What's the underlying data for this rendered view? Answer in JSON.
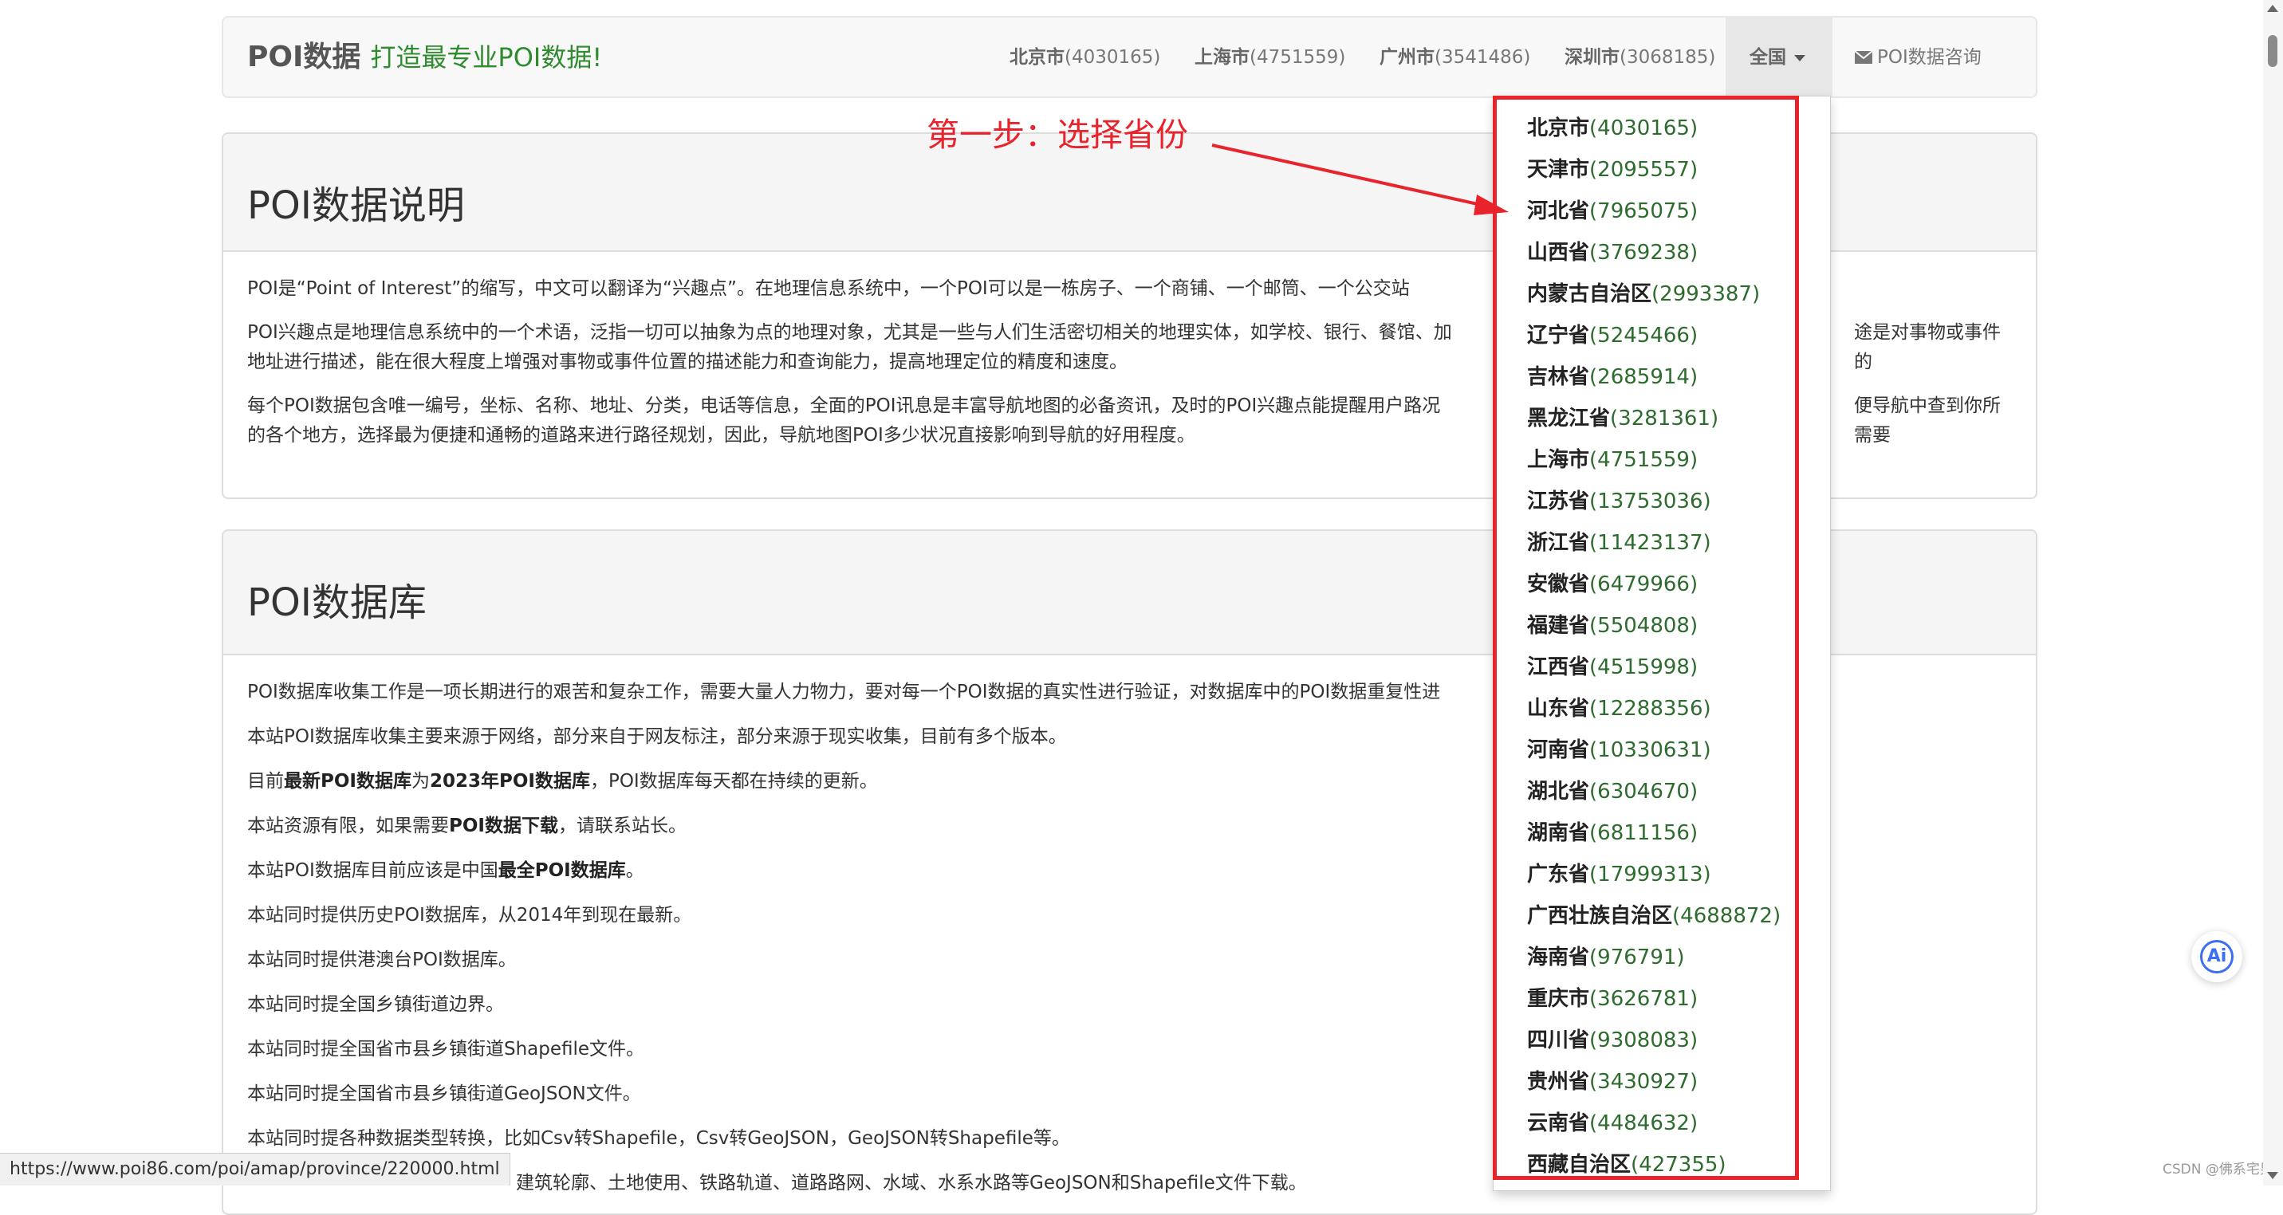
{
  "navbar": {
    "brand_name": "POI数据",
    "brand_slogan": "打造最专业POI数据!",
    "items": [
      {
        "name": "北京市",
        "count": "(4030165)"
      },
      {
        "name": "上海市",
        "count": "(4751559)"
      },
      {
        "name": "广州市",
        "count": "(3541486)"
      },
      {
        "name": "深圳市",
        "count": "(3068185)"
      }
    ],
    "dropdown_label": "全国",
    "consult_label": "POI数据咨询"
  },
  "annotation": {
    "step_label": "第一步：选择省份",
    "highlight_color": "#e8232b"
  },
  "panel1": {
    "title": "POI数据说明",
    "p1": "POI是“Point of Interest”的缩写，中文可以翻译为“兴趣点”。在地理信息系统中，一个POI可以是一栋房子、一个商铺、一个邮筒、一个公交站",
    "p2a": "POI兴趣点是地理信息系统中的一个术语，泛指一切可以抽象为点的地理对象，尤其是一些与人们生活密切相关的地理实体，如学校、银行、餐馆、加",
    "p2b": "途是对事物或事件的",
    "p2c": "地址进行描述，能在很大程度上增强对事物或事件位置的描述能力和查询能力，提高地理定位的精度和速度。",
    "p3a": "每个POI数据包含唯一编号，坐标、名称、地址、分类，电话等信息，全面的POI讯息是丰富导航地图的必备资讯，及时的POI兴趣点能提醒用户路况",
    "p3b": "便导航中查到你所需要",
    "p3c": "的各个地方，选择最为便捷和通畅的道路来进行路径规划，因此，导航地图POI多少状况直接影响到导航的好用程度。"
  },
  "panel2": {
    "title": "POI数据库",
    "l1": "POI数据库收集工作是一项长期进行的艰苦和复杂工作，需要大量人力物力，要对每一个POI数据的真实性进行验证，对数据库中的POI数据重复性进",
    "l2": "本站POI数据库收集主要来源于网络，部分来自于网友标注，部分来源于现实收集，目前有多个版本。",
    "l3_pre": "目前",
    "l3_b1": "最新POI数据库",
    "l3_mid": "为",
    "l3_b2": "2023年POI数据库",
    "l3_post": "，POI数据库每天都在持续的更新。",
    "l4_pre": "本站资源有限，如果需要",
    "l4_b": "POI数据下载",
    "l4_post": "，请联系站长。",
    "l5_pre": "本站POI数据库目前应该是中国",
    "l5_b": "最全POI数据库",
    "l5_post": "。",
    "l6": "本站同时提供历史POI数据库，从2014年到现在最新。",
    "l7": "本站同时提供港澳台POI数据库。",
    "l8": "本站同时提全国乡镇街道边界。",
    "l9": "本站同时提全国省市县乡镇街道Shapefile文件。",
    "l10": "本站同时提全国省市县乡镇街道GeoJSON文件。",
    "l11": "本站同时提各种数据类型转换，比如Csv转Shapefile，Csv转GeoJSON，GeoJSON转Shapefile等。",
    "l12": "建筑轮廓、土地使用、铁路轨道、道路路网、水域、水系水路等GeoJSON和Shapefile文件下载。"
  },
  "dropdown": {
    "items": [
      {
        "name": "北京市",
        "count": "(4030165)"
      },
      {
        "name": "天津市",
        "count": "(2095557)"
      },
      {
        "name": "河北省",
        "count": "(7965075)"
      },
      {
        "name": "山西省",
        "count": "(3769238)"
      },
      {
        "name": "内蒙古自治区",
        "count": "(2993387)"
      },
      {
        "name": "辽宁省",
        "count": "(5245466)"
      },
      {
        "name": "吉林省",
        "count": "(2685914)"
      },
      {
        "name": "黑龙江省",
        "count": "(3281361)"
      },
      {
        "name": "上海市",
        "count": "(4751559)"
      },
      {
        "name": "江苏省",
        "count": "(13753036)"
      },
      {
        "name": "浙江省",
        "count": "(11423137)"
      },
      {
        "name": "安徽省",
        "count": "(6479966)"
      },
      {
        "name": "福建省",
        "count": "(5504808)"
      },
      {
        "name": "江西省",
        "count": "(4515998)"
      },
      {
        "name": "山东省",
        "count": "(12288356)"
      },
      {
        "name": "河南省",
        "count": "(10330631)"
      },
      {
        "name": "湖北省",
        "count": "(6304670)"
      },
      {
        "name": "湖南省",
        "count": "(6811156)"
      },
      {
        "name": "广东省",
        "count": "(17999313)"
      },
      {
        "name": "广西壮族自治区",
        "count": "(4688872)"
      },
      {
        "name": "海南省",
        "count": "(976791)"
      },
      {
        "name": "重庆市",
        "count": "(3626781)"
      },
      {
        "name": "四川省",
        "count": "(9308083)"
      },
      {
        "name": "贵州省",
        "count": "(3430927)"
      },
      {
        "name": "云南省",
        "count": "(4484632)"
      },
      {
        "name": "西藏自治区",
        "count": "(427355)"
      }
    ]
  },
  "statusbar": {
    "url": "https://www.poi86.com/poi/amap/province/220000.html"
  },
  "watermark": "CSDN @佛系宅男",
  "ai_button_label": "Ai"
}
